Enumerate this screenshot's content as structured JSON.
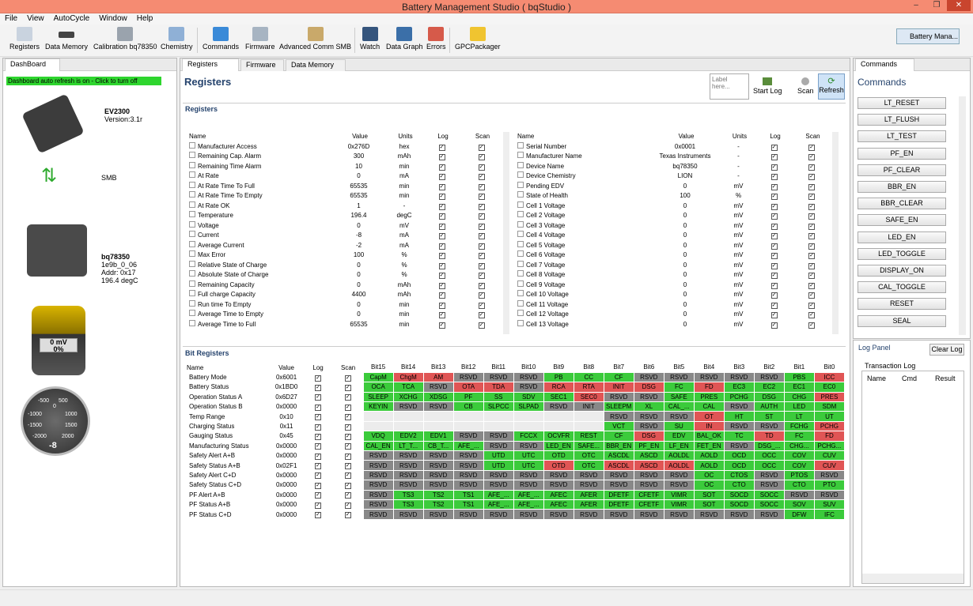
{
  "window": {
    "title": "Battery Management Studio ( bqStudio )",
    "min": "–",
    "max": "❐",
    "close": "✕"
  },
  "menu": [
    "File",
    "View",
    "AutoCycle",
    "Window",
    "Help"
  ],
  "toolbar": [
    "Registers",
    "Data Memory",
    "Calibration bq78350",
    "Chemistry",
    "Commands",
    "Firmware",
    "Advanced Comm SMB",
    "Watch",
    "Data Graph",
    "Errors",
    "GPCPackager"
  ],
  "perspective": "Battery Mana...",
  "dashboard": {
    "tab": "DashBoard",
    "refresh": "Dashboard auto refresh is on - Click to turn off",
    "ev_name": "EV2300",
    "ev_version": "Version:3.1r",
    "smb": "SMB",
    "chip_name": "bq78350",
    "chip_fw": "1e9b_0_06",
    "chip_addr": "Addr: 0x17",
    "chip_temp": "196.4 degC",
    "battery_mv": "0 mV",
    "battery_pct": "0%",
    "gauge_value": "-8",
    "gauge_ticks": [
      "-500",
      "500",
      "-1000",
      "1000",
      "-1500",
      "1500",
      "-2000",
      "2000",
      "0"
    ]
  },
  "tabs": [
    "Registers",
    "Firmware",
    "Data Memory"
  ],
  "registers": {
    "heading": "Registers",
    "section": "Registers",
    "label_placeholder": "Label here...",
    "start_log": "Start Log",
    "scan": "Scan",
    "refresh": "Refresh",
    "columns": [
      "Name",
      "Value",
      "Units",
      "Log",
      "Scan"
    ],
    "left": [
      [
        "Manufacturer Access",
        "0x276D",
        "hex"
      ],
      [
        "Remaining Cap. Alarm",
        "300",
        "mAh"
      ],
      [
        "Remaining Time Alarm",
        "10",
        "min"
      ],
      [
        "At Rate",
        "0",
        "mA"
      ],
      [
        "At Rate Time To Full",
        "65535",
        "min"
      ],
      [
        "At Rate Time To Empty",
        "65535",
        "min"
      ],
      [
        "At Rate OK",
        "1",
        "-"
      ],
      [
        "Temperature",
        "196.4",
        "degC"
      ],
      [
        "Voltage",
        "0",
        "mV"
      ],
      [
        "Current",
        "-8",
        "mA"
      ],
      [
        "Average Current",
        "-2",
        "mA"
      ],
      [
        "Max Error",
        "100",
        "%"
      ],
      [
        "Relative State of Charge",
        "0",
        "%"
      ],
      [
        "Absolute State of Charge",
        "0",
        "%"
      ],
      [
        "Remaining Capacity",
        "0",
        "mAh"
      ],
      [
        "Full charge Capacity",
        "4400",
        "mAh"
      ],
      [
        "Run time To Empty",
        "0",
        "min"
      ],
      [
        "Average Time to Empty",
        "0",
        "min"
      ],
      [
        "Average Time to Full",
        "65535",
        "min"
      ]
    ],
    "right": [
      [
        "Serial Number",
        "0x0001",
        "-"
      ],
      [
        "Manufacturer Name",
        "Texas Instruments",
        "-"
      ],
      [
        "Device Name",
        "bq78350",
        "-"
      ],
      [
        "Device Chemistry",
        "LION",
        "-"
      ],
      [
        "Pending EDV",
        "0",
        "mV"
      ],
      [
        "State of Health",
        "100",
        "%"
      ],
      [
        "Cell 1 Voltage",
        "0",
        "mV"
      ],
      [
        "Cell 2 Voltage",
        "0",
        "mV"
      ],
      [
        "Cell 3 Voltage",
        "0",
        "mV"
      ],
      [
        "Cell 4 Voltage",
        "0",
        "mV"
      ],
      [
        "Cell 5 Voltage",
        "0",
        "mV"
      ],
      [
        "Cell 6 Voltage",
        "0",
        "mV"
      ],
      [
        "Cell 7 Voltage",
        "0",
        "mV"
      ],
      [
        "Cell 8 Voltage",
        "0",
        "mV"
      ],
      [
        "Cell 9 Voltage",
        "0",
        "mV"
      ],
      [
        "Cell 10 Voltage",
        "0",
        "mV"
      ],
      [
        "Cell 11 Voltage",
        "0",
        "mV"
      ],
      [
        "Cell 12 Voltage",
        "0",
        "mV"
      ],
      [
        "Cell 13 Voltage",
        "0",
        "mV"
      ]
    ]
  },
  "bits": {
    "section": "Bit Registers",
    "columns": [
      "Name",
      "Value",
      "Log",
      "Scan",
      "Bit15",
      "Bit14",
      "Bit13",
      "Bit12",
      "Bit11",
      "Bit10",
      "Bit9",
      "Bit8",
      "Bit7",
      "Bit6",
      "Bit5",
      "Bit4",
      "Bit3",
      "Bit2",
      "Bit1",
      "Bit0"
    ],
    "rows": [
      [
        "Battery Mode",
        "0x6001",
        "g:CapM r:ChgM r:AM y:RSVD y:RSVD y:RSVD g:PB g:CC g:CF y:RSVD y:RSVD y:RSVD y:RSVD y:RSVD g:PBS r:ICC"
      ],
      [
        "Battery Status",
        "0x1BD0",
        "g:OCA g:TCA y:RSVD r:OTA r:TDA y:RSVD r:RCA r:RTA r:INIT r:DSG g:FC r:FD g:EC3 g:EC2 g:EC1 g:EC0"
      ],
      [
        "Operation Status A",
        "0x6D27",
        "g:SLEEP g:XCHG g:XDSG g:PF g:SS g:SDV g:SEC1 r:SEC0 y:RSVD y:RSVD g:SAFE g:PRES g:PCHG g:DSG g:CHG r:PRES"
      ],
      [
        "Operation Status B",
        "0x0000",
        "g:KEYIN y:RSVD y:RSVD g:CB g:SLPCC g:SLPAD y:RSVD y:INIT g:SLEEPM g:XL g:CAL_... g:CAL y:RSVD g:AUTH g:LED g:SDM"
      ],
      [
        "Temp Range",
        "0x10",
        "e: e: e: e: e: e: e: e: y:RSVD y:RSVD y:RSVD r:OT g:HT g:ST g:LT g:UT"
      ],
      [
        "Charging Status",
        "0x11",
        "e: e: e: e: e: e: e: e: g:VCT y:RSVD g:SU r:IN y:RSVD y:RSVD g:FCHG r:PCHG"
      ],
      [
        "Gauging Status",
        "0x45",
        "g:VDQ g:EDV2 g:EDV1 y:RSVD y:RSVD g:FCCX g:OCVFR g:REST g:CF r:DSG g:EDV g:BAL_OK g:TC r:TD g:FC r:FD"
      ],
      [
        "Manufacturing Status",
        "0x0000",
        "g:CAL_EN g:LT_T... g:CB_T... g:AFE_... y:RSVD y:RSVD g:LED_EN g:SAFE... g:BBR_EN g:PF_EN g:LF_EN g:FET_EN y:RSVD g:DSG_... g:CHG... g:PCHG..."
      ],
      [
        "Safety Alert A+B",
        "0x0000",
        "y:RSVD y:RSVD y:RSVD y:RSVD g:UTD g:UTC g:OTD g:OTC g:ASCDL g:ASCD g:AOLDL g:AOLD g:OCD g:OCC g:COV g:CUV"
      ],
      [
        "Safety Status A+B",
        "0x02F1",
        "y:RSVD y:RSVD y:RSVD y:RSVD g:UTD g:UTC r:OTD g:OTC r:ASCDL r:ASCD r:AOLDL g:AOLD g:OCD g:OCC g:COV r:CUV"
      ],
      [
        "Safety Alert C+D",
        "0x0000",
        "y:RSVD y:RSVD y:RSVD y:RSVD y:RSVD y:RSVD y:RSVD y:RSVD y:RSVD y:RSVD y:RSVD g:OC g:CTOS y:RSVD g:PTOS y:RSVD"
      ],
      [
        "Safety Status C+D",
        "0x0000",
        "y:RSVD y:RSVD y:RSVD y:RSVD y:RSVD y:RSVD y:RSVD y:RSVD y:RSVD y:RSVD y:RSVD g:OC g:CTO y:RSVD g:CTO g:PTO"
      ],
      [
        "PF Alert A+B",
        "0x0000",
        "y:RSVD g:TS3 g:TS2 g:TS1 g:AFE_... g:AFE_... g:AFEC g:AFER g:DFETF g:CFETF g:VIMR g:SOT g:SOCD g:SOCC y:RSVD y:RSVD"
      ],
      [
        "PF Status A+B",
        "0x0000",
        "y:RSVD g:TS3 g:TS2 g:TS1 g:AFE_... g:AFE_... g:AFEC g:AFER g:DFETF g:CFETF g:VIMR g:SOT g:SOCD g:SOCC g:SOV g:SUV"
      ],
      [
        "PF Status C+D",
        "0x0000",
        "y:RSVD y:RSVD y:RSVD y:RSVD y:RSVD y:RSVD y:RSVD y:RSVD y:RSVD y:RSVD y:RSVD y:RSVD y:RSVD y:RSVD g:DFW g:IFC"
      ]
    ]
  },
  "commands": {
    "tab": "Commands",
    "heading": "Commands",
    "items": [
      "LT_RESET",
      "LT_FLUSH",
      "LT_TEST",
      "PF_EN",
      "PF_CLEAR",
      "BBR_EN",
      "BBR_CLEAR",
      "SAFE_EN",
      "LED_EN",
      "LED_TOGGLE",
      "DISPLAY_ON",
      "CAL_TOGGLE",
      "RESET",
      "SEAL"
    ]
  },
  "log": {
    "heading": "Log Panel",
    "clear": "Clear Log",
    "transaction": "Transaction Log",
    "columns": [
      "Name",
      "Cmd",
      "Result"
    ]
  }
}
